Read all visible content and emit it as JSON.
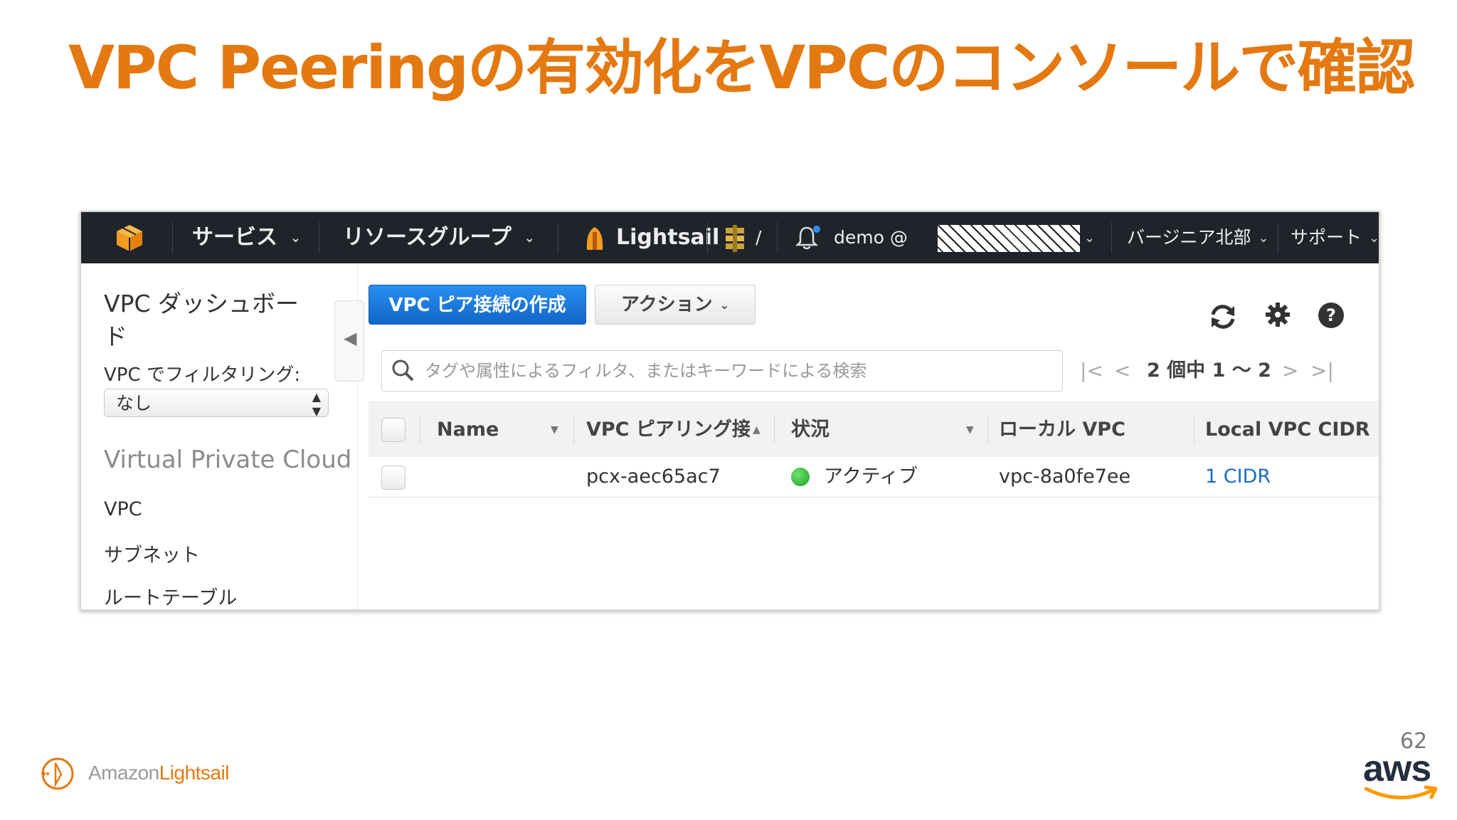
{
  "slide": {
    "title": "VPC Peeringの有効化をVPCのコンソールで確認",
    "page_number": "62",
    "footer_brand_prefix": "Amazon",
    "footer_brand_suffix": "Lightsail",
    "aws_logo_text": "aws",
    "colors": {
      "title": "#e47911",
      "nav_bg": "#1f242b",
      "primary_button": "#1a73d9",
      "link": "#1a6fc4",
      "active": "#1ea31e"
    }
  },
  "nav": {
    "services": "サービス",
    "resource_groups": "リソースグループ",
    "lightsail": "Lightsail",
    "pinned_more": "/",
    "account": "demo @",
    "region": "バージニア北部",
    "support": "サポート",
    "icons": [
      "aws-cube-icon",
      "lightsail-icon",
      "pinned-service-icon",
      "bell-icon"
    ]
  },
  "sidebar": {
    "title": "VPC ダッシュボード",
    "filter_label": "VPC でフィルタリング:",
    "filter_value": "なし",
    "section": "Virtual Private Cloud",
    "links": [
      "VPC",
      "サブネット",
      "ルートテーブル"
    ]
  },
  "toolbar": {
    "create_button": "VPC ピア接続の作成",
    "actions_button": "アクション",
    "icons": [
      "refresh-icon",
      "gear-icon",
      "help-icon"
    ]
  },
  "search": {
    "placeholder": "タグや属性によるフィルタ、またはキーワードによる検索"
  },
  "pagination": {
    "text": "2 個中 1 〜 2"
  },
  "table": {
    "columns": [
      "Name",
      "VPC ピアリング接続",
      "状況",
      "ローカル VPC",
      "Local VPC CIDR"
    ],
    "rows": [
      {
        "name": "",
        "peering_id": "pcx-aec65ac7",
        "status": "アクティブ",
        "local_vpc": "vpc-8a0fe7ee",
        "local_cidr": "1 CIDR"
      }
    ]
  }
}
